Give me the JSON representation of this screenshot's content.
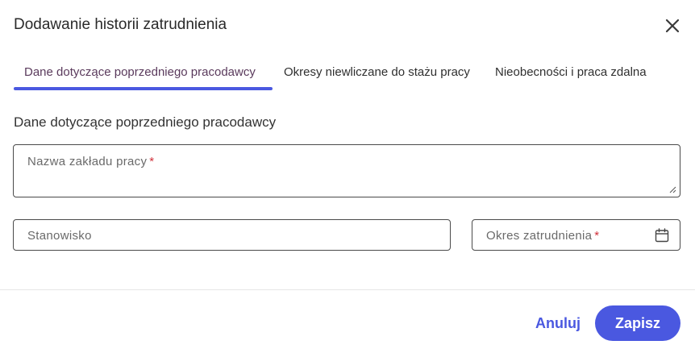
{
  "dialog": {
    "title": "Dodawanie historii zatrudnienia",
    "close_icon": "close-icon"
  },
  "tabs": [
    {
      "label": "Dane dotyczące poprzedniego pracodawcy",
      "active": true
    },
    {
      "label": "Okresy niewliczane do stażu pracy",
      "active": false
    },
    {
      "label": "Nieobecności i praca zdalna",
      "active": false
    }
  ],
  "section": {
    "title": "Dane dotyczące poprzedniego pracodawcy"
  },
  "fields": {
    "employer_name": {
      "label": "Nazwa zakładu pracy",
      "required_mark": "*",
      "value": ""
    },
    "position": {
      "label": "Stanowisko",
      "value": ""
    },
    "employment_period": {
      "label": "Okres zatrudnienia",
      "required_mark": "*",
      "value": "",
      "icon": "calendar-icon"
    }
  },
  "footer": {
    "cancel_label": "Anuluj",
    "save_label": "Zapisz"
  },
  "colors": {
    "accent": "#4a58e0",
    "required": "#d0303a",
    "active_tab_text": "#5a3a5c"
  }
}
